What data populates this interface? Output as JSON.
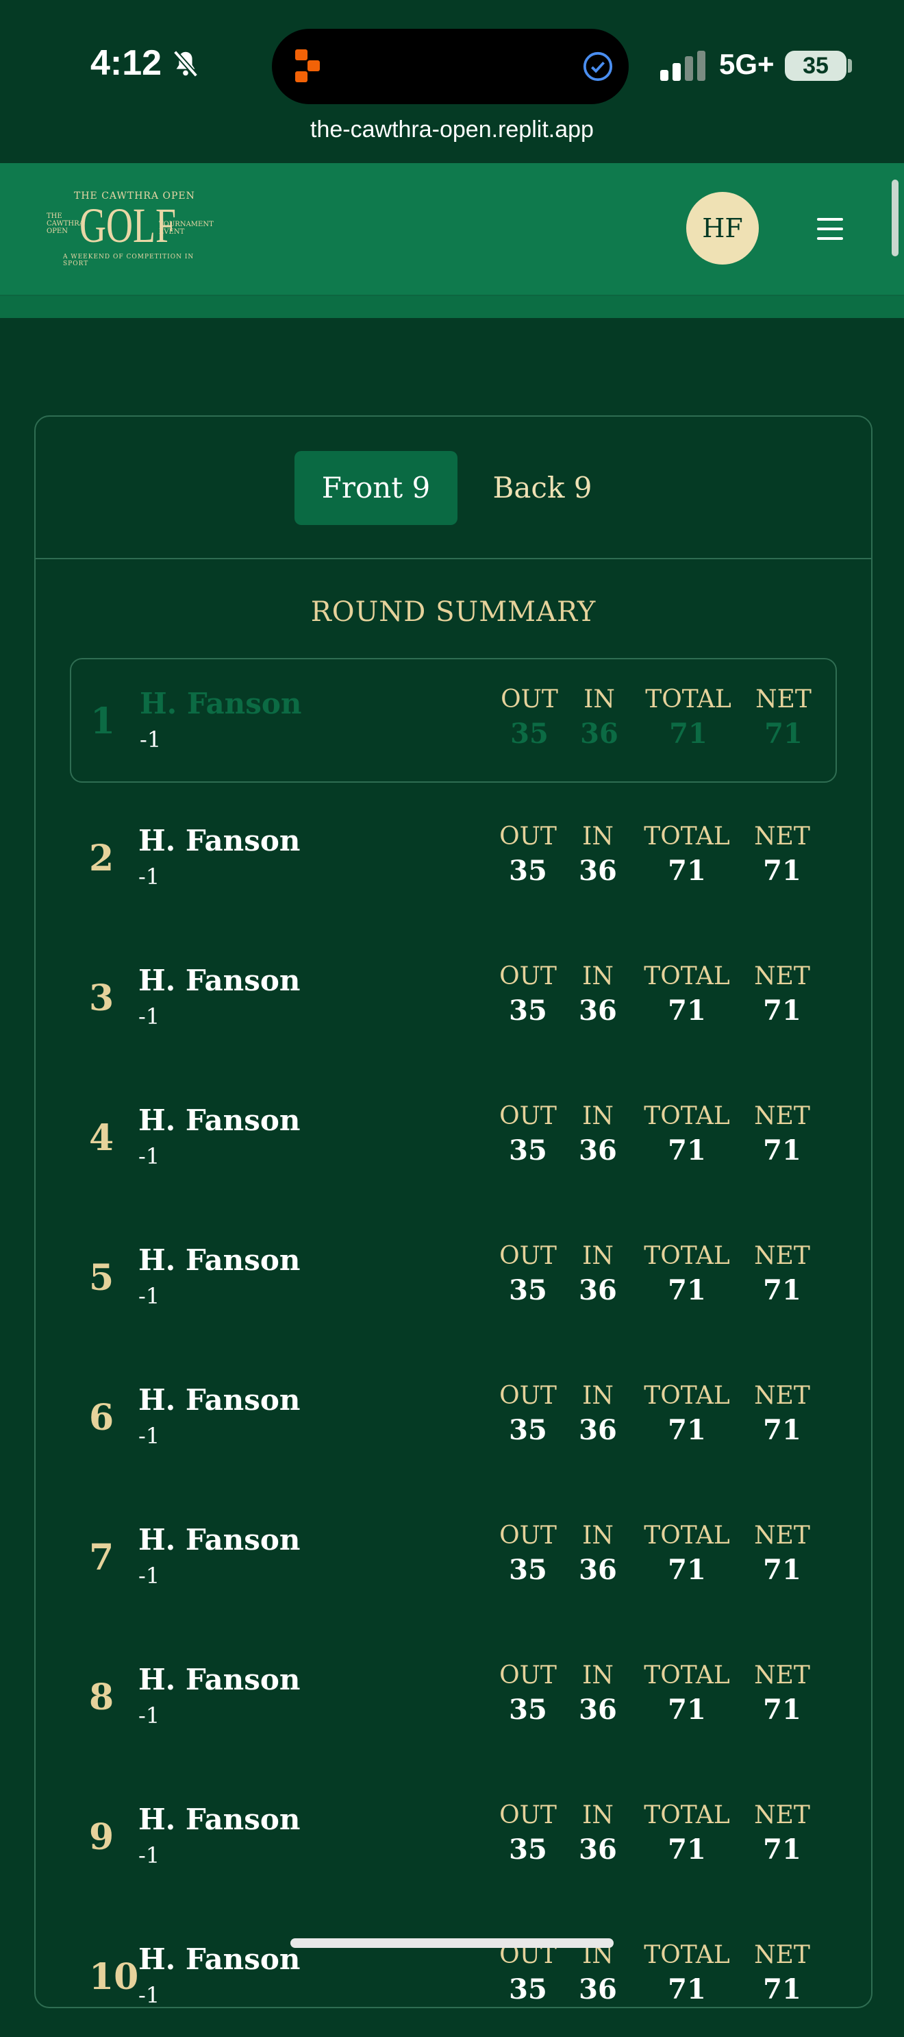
{
  "status_bar": {
    "time": "4:12",
    "network": "5G+",
    "battery": "35"
  },
  "browser": {
    "url": "the-cawthra-open.replit.app"
  },
  "header": {
    "logo": {
      "top": "THE CAWTHRA OPEN",
      "main": "GOLF",
      "left": "THE CAWTHRA OPEN",
      "right": "TOURNAMENT EVENT",
      "bottom": "A WEEKEND OF COMPETITION IN SPORT"
    },
    "avatar_initials": "HF"
  },
  "tabs": [
    {
      "label": "Front 9",
      "active": true
    },
    {
      "label": "Back 9",
      "active": false
    }
  ],
  "summary": {
    "title": "ROUND SUMMARY",
    "columns": {
      "out": "OUT",
      "in": "IN",
      "total": "TOTAL",
      "net": "NET"
    },
    "rows": [
      {
        "rank": "1",
        "name": "H. Fanson",
        "score": "-1",
        "out": "35",
        "in": "36",
        "total": "71",
        "net": "71"
      },
      {
        "rank": "2",
        "name": "H. Fanson",
        "score": "-1",
        "out": "35",
        "in": "36",
        "total": "71",
        "net": "71"
      },
      {
        "rank": "3",
        "name": "H. Fanson",
        "score": "-1",
        "out": "35",
        "in": "36",
        "total": "71",
        "net": "71"
      },
      {
        "rank": "4",
        "name": "H. Fanson",
        "score": "-1",
        "out": "35",
        "in": "36",
        "total": "71",
        "net": "71"
      },
      {
        "rank": "5",
        "name": "H. Fanson",
        "score": "-1",
        "out": "35",
        "in": "36",
        "total": "71",
        "net": "71"
      },
      {
        "rank": "6",
        "name": "H. Fanson",
        "score": "-1",
        "out": "35",
        "in": "36",
        "total": "71",
        "net": "71"
      },
      {
        "rank": "7",
        "name": "H. Fanson",
        "score": "-1",
        "out": "35",
        "in": "36",
        "total": "71",
        "net": "71"
      },
      {
        "rank": "8",
        "name": "H. Fanson",
        "score": "-1",
        "out": "35",
        "in": "36",
        "total": "71",
        "net": "71"
      },
      {
        "rank": "9",
        "name": "H. Fanson",
        "score": "-1",
        "out": "35",
        "in": "36",
        "total": "71",
        "net": "71"
      },
      {
        "rank": "10",
        "name": "H. Fanson",
        "score": "-1",
        "out": "35",
        "in": "36",
        "total": "71",
        "net": "71"
      }
    ]
  }
}
